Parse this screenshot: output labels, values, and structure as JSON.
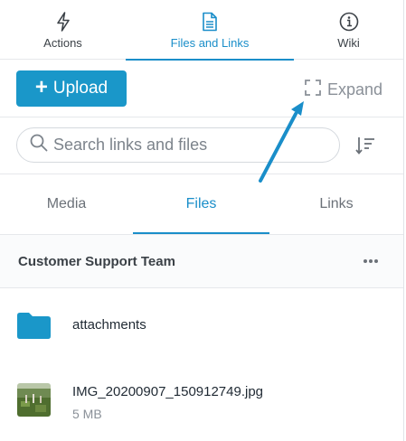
{
  "top_tabs": [
    {
      "id": "actions",
      "label": "Actions",
      "icon": "lightning-icon",
      "active": false
    },
    {
      "id": "files",
      "label": "Files and Links",
      "icon": "document-icon",
      "active": true
    },
    {
      "id": "wiki",
      "label": "Wiki",
      "icon": "info-icon",
      "active": false
    }
  ],
  "toolbar": {
    "upload_label": "Upload",
    "upload_icon": "plus-icon",
    "expand_label": "Expand",
    "expand_icon": "expand-icon"
  },
  "search": {
    "placeholder": "Search links and files",
    "value": "",
    "icon": "search-icon",
    "sort_icon": "sort-icon"
  },
  "sub_tabs": [
    {
      "id": "media",
      "label": "Media",
      "active": false
    },
    {
      "id": "files",
      "label": "Files",
      "active": true
    },
    {
      "id": "links",
      "label": "Links",
      "active": false
    }
  ],
  "section": {
    "title": "Customer Support Team",
    "more_icon": "more-horizontal-icon"
  },
  "items": [
    {
      "type": "folder",
      "name": "attachments",
      "icon": "folder-icon"
    },
    {
      "type": "image",
      "name": "IMG_20200907_150912749.jpg",
      "size": "5 MB",
      "icon": "image-thumbnail"
    }
  ],
  "colors": {
    "accent": "#1a97c9",
    "annotation_arrow": "#1a8ec9",
    "folder": "#1a97c9"
  }
}
